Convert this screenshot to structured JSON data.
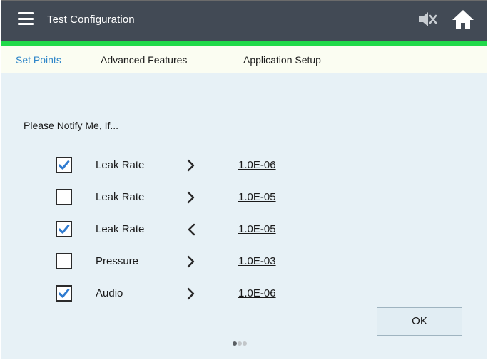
{
  "header": {
    "title": "Test Configuration",
    "menu_icon": "hamburger-menu-icon",
    "mute_icon": "speaker-muted-icon",
    "home_icon": "home-icon"
  },
  "colors": {
    "header_bg": "#424a55",
    "accent": "#21d94a",
    "active_tab": "#2f86c9",
    "checkbox_check": "#2f7bd0",
    "content_bg": "#e7f1f6"
  },
  "tabs": [
    {
      "label": "Set Points",
      "active": true
    },
    {
      "label": "Advanced Features",
      "active": false
    },
    {
      "label": "Application Setup",
      "active": false
    }
  ],
  "main": {
    "prompt": "Please Notify Me, If...",
    "rows": [
      {
        "checked": true,
        "label": "Leak Rate",
        "comparator": "greater-than",
        "value": "1.0E-06"
      },
      {
        "checked": false,
        "label": "Leak Rate",
        "comparator": "greater-than",
        "value": "1.0E-05"
      },
      {
        "checked": true,
        "label": "Leak Rate",
        "comparator": "less-than",
        "value": "1.0E-05"
      },
      {
        "checked": false,
        "label": "Pressure",
        "comparator": "greater-than",
        "value": "1.0E-03"
      },
      {
        "checked": true,
        "label": "Audio",
        "comparator": "greater-than",
        "value": "1.0E-06"
      }
    ],
    "page_indicator": {
      "current": 1,
      "total": 3
    },
    "ok_label": "OK"
  }
}
